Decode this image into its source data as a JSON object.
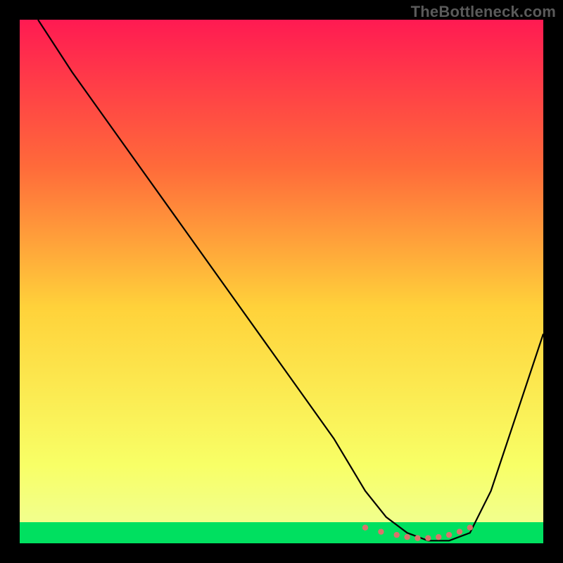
{
  "watermark": "TheBottleneck.com",
  "chart_data": {
    "type": "line",
    "title": "",
    "xlabel": "",
    "ylabel": "",
    "xlim": [
      0,
      100
    ],
    "ylim": [
      0,
      100
    ],
    "grid": false,
    "legend": false,
    "background_gradient": {
      "top_color": "#ff1a52",
      "upper_mid_color": "#ff6a3a",
      "mid_color": "#ffd23a",
      "lower_mid_color": "#f8ff66",
      "bottom_band_color": "#00e060"
    },
    "series": [
      {
        "name": "bottleneck-curve",
        "color": "#000000",
        "x": [
          3.5,
          10,
          20,
          30,
          40,
          50,
          60,
          66,
          70,
          74,
          78,
          82,
          86,
          90,
          94,
          100
        ],
        "y": [
          100,
          90,
          76,
          62,
          48,
          34,
          20,
          10,
          5,
          2,
          0.5,
          0.5,
          2,
          10,
          22,
          40
        ]
      },
      {
        "name": "optimal-marker-dots",
        "type": "scatter",
        "color": "#d9736b",
        "x": [
          66,
          69,
          72,
          74,
          76,
          78,
          80,
          82,
          84,
          86
        ],
        "y": [
          3.0,
          2.2,
          1.6,
          1.2,
          1.0,
          1.0,
          1.2,
          1.6,
          2.2,
          3.0
        ]
      }
    ]
  }
}
